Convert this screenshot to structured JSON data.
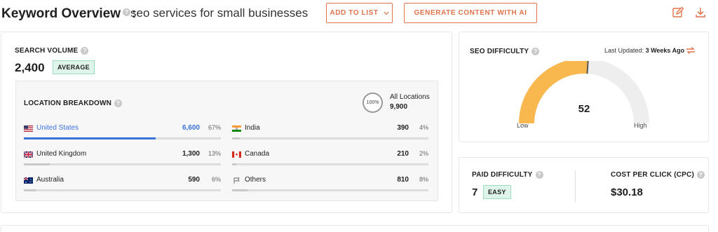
{
  "header": {
    "title": "Keyword Overview",
    "colon": ":",
    "keyword": "seo services for small businesses",
    "add_to_list_label": "ADD TO LIST",
    "generate_label": "GENERATE CONTENT WITH AI",
    "help_glyph": "?"
  },
  "search_volume": {
    "label": "SEARCH VOLUME",
    "value": "2,400",
    "badge": "AVERAGE"
  },
  "location_breakdown": {
    "title": "LOCATION BREAKDOWN",
    "ring_label": "100%",
    "all_locations_label": "All Locations",
    "all_locations_value": "9,900",
    "rows": [
      {
        "name": "United States",
        "count": "6,600",
        "pct": "67%",
        "share": 0.67,
        "flag": "us-flag-icon",
        "active": true
      },
      {
        "name": "India",
        "count": "390",
        "pct": "4%",
        "share": 0.04,
        "flag": "india-flag-icon",
        "active": false
      },
      {
        "name": "United Kingdom",
        "count": "1,300",
        "pct": "13%",
        "share": 0.13,
        "flag": "uk-flag-icon",
        "active": false
      },
      {
        "name": "Canada",
        "count": "210",
        "pct": "2%",
        "share": 0.02,
        "flag": "canada-flag-icon",
        "active": false
      },
      {
        "name": "Australia",
        "count": "590",
        "pct": "6%",
        "share": 0.06,
        "flag": "australia-flag-icon",
        "active": false
      },
      {
        "name": "Others",
        "count": "810",
        "pct": "8%",
        "share": 0.08,
        "flag": "flag-outline-icon",
        "active": false
      }
    ]
  },
  "seo_difficulty": {
    "label": "SEO DIFFICULTY",
    "last_updated_label": "Last Updated:",
    "last_updated_value": "3 Weeks Ago",
    "value": "52",
    "score": 52,
    "max": 100,
    "low_label": "Low",
    "high_label": "High"
  },
  "paid_difficulty": {
    "label": "PAID DIFFICULTY",
    "value": "7",
    "badge": "EASY"
  },
  "cpc": {
    "label": "COST PER CLICK (CPC)",
    "value": "$30.18"
  },
  "colors": {
    "accent": "#e0734a",
    "active_blue": "#3b72d8",
    "gauge_fill": "#f8b84e",
    "gauge_track": "#eeeeee",
    "badge_bg": "#dff5ec",
    "badge_border": "#9edcbf"
  }
}
